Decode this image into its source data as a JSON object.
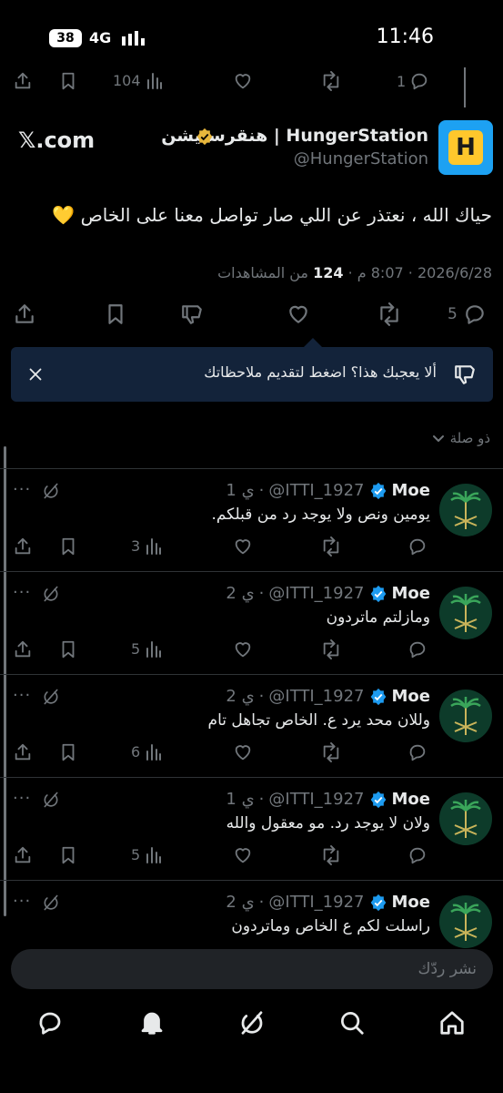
{
  "status_bar": {
    "battery": "38",
    "network": "4G",
    "time": "11:46"
  },
  "prev_tweet": {
    "views": "104",
    "replies": "1"
  },
  "main_tweet": {
    "display_name": "هنقرستيشن | HungerStation",
    "handle": "@HungerStation",
    "source": "𝕏.com",
    "text": "حياك الله ، نعتذر عن اللي صار تواصل معنا على الخاص 💛",
    "date": "2026/6/28",
    "time": "8:07 م",
    "views_count": "124",
    "views_label": "من المشاهدات",
    "replies_count": "5",
    "avatar_letter": "H"
  },
  "feedback_banner": {
    "text": "ألا يعجبك هذا؟ اضغط لتقديم ملاحظاتك"
  },
  "sort_label": "ذو صلة",
  "replies": [
    {
      "name": "Moe",
      "handle": "@ITTI_1927",
      "age": "1 ي",
      "text": "يومين ونص ولا يوجد رد من قبلكم.",
      "views": "3"
    },
    {
      "name": "Moe",
      "handle": "@ITTI_1927",
      "age": "2 ي",
      "text": "ومازلتم ماتردون",
      "views": "5"
    },
    {
      "name": "Moe",
      "handle": "@ITTI_1927",
      "age": "2 ي",
      "text": "وللان محد يرد ع. الخاص تجاهل تام",
      "views": "6"
    },
    {
      "name": "Moe",
      "handle": "@ITTI_1927",
      "age": "1 ي",
      "text": "ولان لا يوجد رد. مو معقول والله",
      "views": "5"
    },
    {
      "name": "Moe",
      "handle": "@ITTI_1927",
      "age": "2 ي",
      "text": "راسلت لكم ع الخاص وماتردون",
      "views": ""
    }
  ],
  "composer": {
    "placeholder": "نشر ردّك"
  },
  "colors": {
    "background": "#000000",
    "verified": "#1d9bf0",
    "gold_badge": "#e8b73c",
    "banner": "#13233a"
  },
  "icons": [
    "share-icon",
    "bookmark-icon",
    "views-icon",
    "like-icon",
    "retweet-icon",
    "reply-icon",
    "dislike-icon",
    "close-icon",
    "grok-icon",
    "more-icon",
    "home-icon",
    "search-icon",
    "notifications-icon",
    "messages-icon"
  ]
}
